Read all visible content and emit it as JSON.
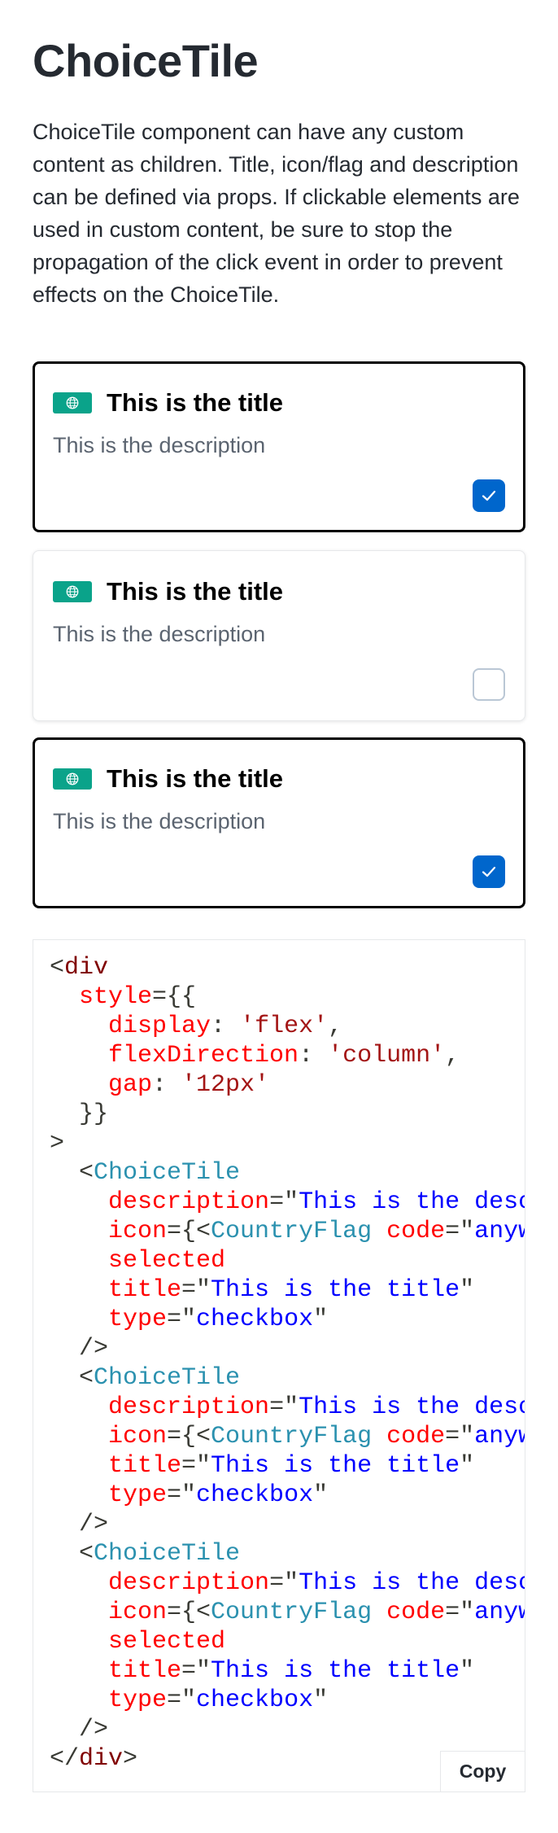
{
  "heading": "ChoiceTile",
  "intro": "ChoiceTile component can have any custom content as children. Title, icon/flag and description can be defined via props. If clickable elements are used in custom content, be sure to stop the propagation of the click event in order to prevent effects on the ChoiceTile.",
  "tiles": [
    {
      "title": "This is the title",
      "description": "This is the description",
      "selected": true,
      "icon": "globe-icon"
    },
    {
      "title": "This is the title",
      "description": "This is the description",
      "selected": false,
      "icon": "globe-icon"
    },
    {
      "title": "This is the title",
      "description": "This is the description",
      "selected": true,
      "icon": "globe-icon"
    }
  ],
  "code": {
    "lines": [
      [
        [
          "t-punc",
          "<"
        ],
        [
          "t-tag",
          "div"
        ]
      ],
      [
        [
          "t-punc",
          "  "
        ],
        [
          "t-attr",
          "style"
        ],
        [
          "t-punc",
          "={{"
        ]
      ],
      [
        [
          "t-punc",
          "    "
        ],
        [
          "t-attr",
          "display"
        ],
        [
          "t-punc",
          ": "
        ],
        [
          "t-str",
          "'flex'"
        ],
        [
          "t-punc",
          ","
        ]
      ],
      [
        [
          "t-punc",
          "    "
        ],
        [
          "t-attr",
          "flexDirection"
        ],
        [
          "t-punc",
          ": "
        ],
        [
          "t-str",
          "'column'"
        ],
        [
          "t-punc",
          ","
        ]
      ],
      [
        [
          "t-punc",
          "    "
        ],
        [
          "t-attr",
          "gap"
        ],
        [
          "t-punc",
          ": "
        ],
        [
          "t-str",
          "'12px'"
        ]
      ],
      [
        [
          "t-punc",
          "  }}"
        ]
      ],
      [
        [
          "t-punc",
          ">"
        ]
      ],
      [
        [
          "t-punc",
          "  <"
        ],
        [
          "t-comp",
          "ChoiceTile"
        ]
      ],
      [
        [
          "t-punc",
          "    "
        ],
        [
          "t-attr",
          "description"
        ],
        [
          "t-punc",
          "=\""
        ],
        [
          "t-val",
          "This is the description"
        ],
        [
          "t-punc",
          "\""
        ]
      ],
      [
        [
          "t-punc",
          "    "
        ],
        [
          "t-attr",
          "icon"
        ],
        [
          "t-punc",
          "={<"
        ],
        [
          "t-comp",
          "CountryFlag"
        ],
        [
          "t-punc",
          " "
        ],
        [
          "t-attr",
          "code"
        ],
        [
          "t-punc",
          "=\""
        ],
        [
          "t-val",
          "anywhere"
        ],
        [
          "t-punc",
          "\" />}"
        ]
      ],
      [
        [
          "t-punc",
          "    "
        ],
        [
          "t-attr",
          "selected"
        ]
      ],
      [
        [
          "t-punc",
          "    "
        ],
        [
          "t-attr",
          "title"
        ],
        [
          "t-punc",
          "=\""
        ],
        [
          "t-val",
          "This is the title"
        ],
        [
          "t-punc",
          "\""
        ]
      ],
      [
        [
          "t-punc",
          "    "
        ],
        [
          "t-attr",
          "type"
        ],
        [
          "t-punc",
          "=\""
        ],
        [
          "t-val",
          "checkbox"
        ],
        [
          "t-punc",
          "\""
        ]
      ],
      [
        [
          "t-punc",
          "  />"
        ]
      ],
      [
        [
          "t-punc",
          "  <"
        ],
        [
          "t-comp",
          "ChoiceTile"
        ]
      ],
      [
        [
          "t-punc",
          "    "
        ],
        [
          "t-attr",
          "description"
        ],
        [
          "t-punc",
          "=\""
        ],
        [
          "t-val",
          "This is the description"
        ],
        [
          "t-punc",
          "\""
        ]
      ],
      [
        [
          "t-punc",
          "    "
        ],
        [
          "t-attr",
          "icon"
        ],
        [
          "t-punc",
          "={<"
        ],
        [
          "t-comp",
          "CountryFlag"
        ],
        [
          "t-punc",
          " "
        ],
        [
          "t-attr",
          "code"
        ],
        [
          "t-punc",
          "=\""
        ],
        [
          "t-val",
          "anywhere"
        ],
        [
          "t-punc",
          "\" />}"
        ]
      ],
      [
        [
          "t-punc",
          "    "
        ],
        [
          "t-attr",
          "title"
        ],
        [
          "t-punc",
          "=\""
        ],
        [
          "t-val",
          "This is the title"
        ],
        [
          "t-punc",
          "\""
        ]
      ],
      [
        [
          "t-punc",
          "    "
        ],
        [
          "t-attr",
          "type"
        ],
        [
          "t-punc",
          "=\""
        ],
        [
          "t-val",
          "checkbox"
        ],
        [
          "t-punc",
          "\""
        ]
      ],
      [
        [
          "t-punc",
          "  />"
        ]
      ],
      [
        [
          "t-punc",
          "  <"
        ],
        [
          "t-comp",
          "ChoiceTile"
        ]
      ],
      [
        [
          "t-punc",
          "    "
        ],
        [
          "t-attr",
          "description"
        ],
        [
          "t-punc",
          "=\""
        ],
        [
          "t-val",
          "This is the description"
        ],
        [
          "t-punc",
          "\""
        ]
      ],
      [
        [
          "t-punc",
          "    "
        ],
        [
          "t-attr",
          "icon"
        ],
        [
          "t-punc",
          "={<"
        ],
        [
          "t-comp",
          "CountryFlag"
        ],
        [
          "t-punc",
          " "
        ],
        [
          "t-attr",
          "code"
        ],
        [
          "t-punc",
          "=\""
        ],
        [
          "t-val",
          "anywhere"
        ],
        [
          "t-punc",
          "\" />}"
        ]
      ],
      [
        [
          "t-punc",
          "    "
        ],
        [
          "t-attr",
          "selected"
        ]
      ],
      [
        [
          "t-punc",
          "    "
        ],
        [
          "t-attr",
          "title"
        ],
        [
          "t-punc",
          "=\""
        ],
        [
          "t-val",
          "This is the title"
        ],
        [
          "t-punc",
          "\""
        ]
      ],
      [
        [
          "t-punc",
          "    "
        ],
        [
          "t-attr",
          "type"
        ],
        [
          "t-punc",
          "=\""
        ],
        [
          "t-val",
          "checkbox"
        ],
        [
          "t-punc",
          "\""
        ]
      ],
      [
        [
          "t-punc",
          "  />"
        ]
      ],
      [
        [
          "t-punc",
          "</"
        ],
        [
          "t-tag",
          "div"
        ],
        [
          "t-punc",
          ">"
        ]
      ]
    ]
  },
  "copy_label": "Copy",
  "colors": {
    "accent": "#0066cc",
    "flag": "#0aa38a",
    "text": "#252a31",
    "muted": "#5b6470"
  }
}
